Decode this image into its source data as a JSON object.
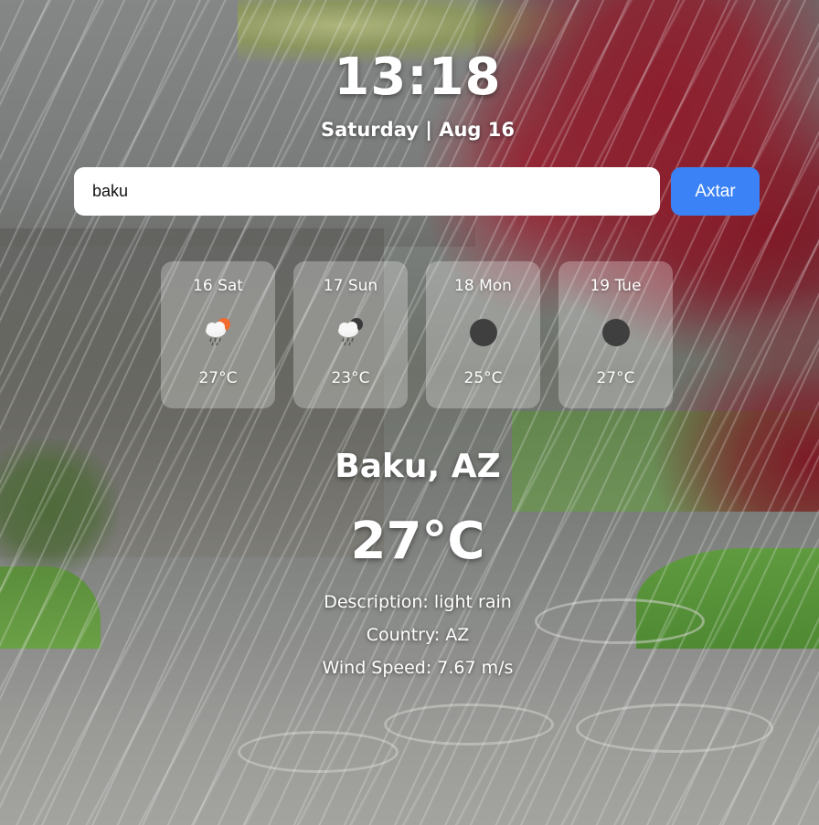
{
  "header": {
    "time": "13:18",
    "date": "Saturday | Aug 16"
  },
  "search": {
    "value": "baku",
    "button_label": "Axtar"
  },
  "forecast": [
    {
      "day": "16 Sat",
      "temp": "27°C",
      "icon": "cloud-rain-sun-icon"
    },
    {
      "day": "17 Sun",
      "temp": "23°C",
      "icon": "cloud-rain-moon-icon"
    },
    {
      "day": "18 Mon",
      "temp": "25°C",
      "icon": "dark-circle-icon"
    },
    {
      "day": "19 Tue",
      "temp": "27°C",
      "icon": "dark-circle-icon"
    }
  ],
  "current": {
    "city": "Baku, AZ",
    "temperature": "27°C",
    "description": "Description: light rain",
    "country": "Country: AZ",
    "wind": "Wind Speed: 7.67 m/s"
  },
  "colors": {
    "button": "#3b82f6",
    "card": "rgba(255,255,255,0.28)",
    "text": "#ffffff"
  }
}
